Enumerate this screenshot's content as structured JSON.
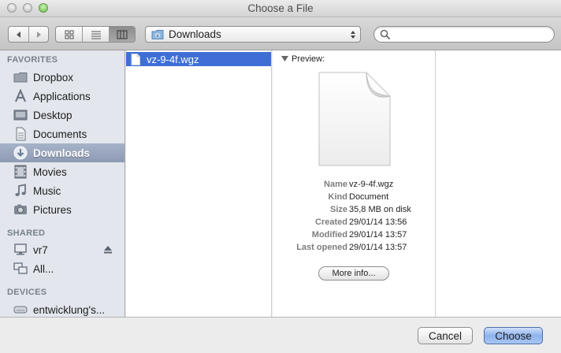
{
  "window": {
    "title": "Choose a File"
  },
  "toolbar": {
    "location": "Downloads",
    "search_value": ""
  },
  "sidebar": {
    "favorites_header": "FAVORITES",
    "favorites": [
      {
        "label": "Dropbox",
        "icon": "dropbox-icon"
      },
      {
        "label": "Applications",
        "icon": "applications-icon"
      },
      {
        "label": "Desktop",
        "icon": "desktop-icon"
      },
      {
        "label": "Documents",
        "icon": "documents-icon"
      },
      {
        "label": "Downloads",
        "icon": "downloads-icon",
        "selected": true
      },
      {
        "label": "Movies",
        "icon": "movies-icon"
      },
      {
        "label": "Music",
        "icon": "music-icon"
      },
      {
        "label": "Pictures",
        "icon": "pictures-icon"
      }
    ],
    "shared_header": "SHARED",
    "shared": [
      {
        "label": "vr7",
        "icon": "computer-icon",
        "eject": true
      },
      {
        "label": "All...",
        "icon": "network-icon"
      }
    ],
    "devices_header": "DEVICES",
    "devices": [
      {
        "label": "entwicklung's...",
        "icon": "disk-icon"
      }
    ]
  },
  "files": [
    {
      "name": "vz-9-4f.wgz",
      "selected": true
    }
  ],
  "preview": {
    "header": "Preview:",
    "info": [
      {
        "key": "Name",
        "value": "vz-9-4f.wgz"
      },
      {
        "key": "Kind",
        "value": "Document"
      },
      {
        "key": "Size",
        "value": "35,8 MB on disk"
      },
      {
        "key": "Created",
        "value": "29/01/14 13:56"
      },
      {
        "key": "Modified",
        "value": "29/01/14 13:57"
      },
      {
        "key": "Last opened",
        "value": "29/01/14 13:57"
      }
    ],
    "more_info_label": "More info..."
  },
  "buttons": {
    "cancel": "Cancel",
    "choose": "Choose"
  },
  "colors": {
    "selection": "#3f6fd6",
    "sidebar_bg": "#e3e7ed",
    "default_button": "#8fb3ee"
  }
}
